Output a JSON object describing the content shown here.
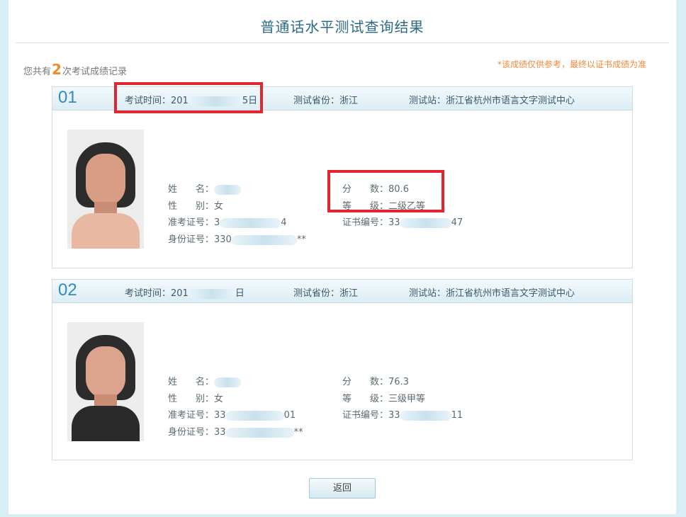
{
  "page": {
    "title": "普通话水平测试查询结果",
    "summary_prefix": "您共有",
    "summary_count": "2",
    "summary_suffix": "次考试成绩记录",
    "notice": "*该成绩仅供参考，最终以证书成绩为准",
    "back_button": "返回"
  },
  "labels": {
    "name": "姓　　名：",
    "gender": "性　　别：",
    "admission_no": "准考证号：",
    "id_no": "身份证号：",
    "score": "分　　数：",
    "level": "等　　级：",
    "cert_no": "证书编号："
  },
  "records": [
    {
      "no": "01",
      "exam_time_label": "考试时间：",
      "exam_time_start": "201",
      "exam_time_end": "5日",
      "province": "测试省份：浙江",
      "station": "测试站：浙江省杭州市语言文字测试中心",
      "name": "",
      "gender": "女",
      "admission_start": "3",
      "admission_end": "4",
      "id_start": "330",
      "id_end": "**",
      "score": "80.6",
      "level": "二级乙等",
      "cert_start": "33",
      "cert_end": "47"
    },
    {
      "no": "02",
      "exam_time_label": "考试时间：",
      "exam_time_start": "201",
      "exam_time_end": "日",
      "province": "测试省份：浙江",
      "station": "测试站：浙江省杭州市语言文字测试中心",
      "name": "",
      "gender": "女",
      "admission_start": "33",
      "admission_end": "01",
      "id_start": "33",
      "id_end": "**",
      "score": "76.3",
      "level": "三级甲等",
      "cert_start": "33",
      "cert_end": "11"
    }
  ],
  "colors": {
    "accent": "#2f8dbd",
    "highlight_box": "#e0262e",
    "notice": "#f0883a"
  }
}
